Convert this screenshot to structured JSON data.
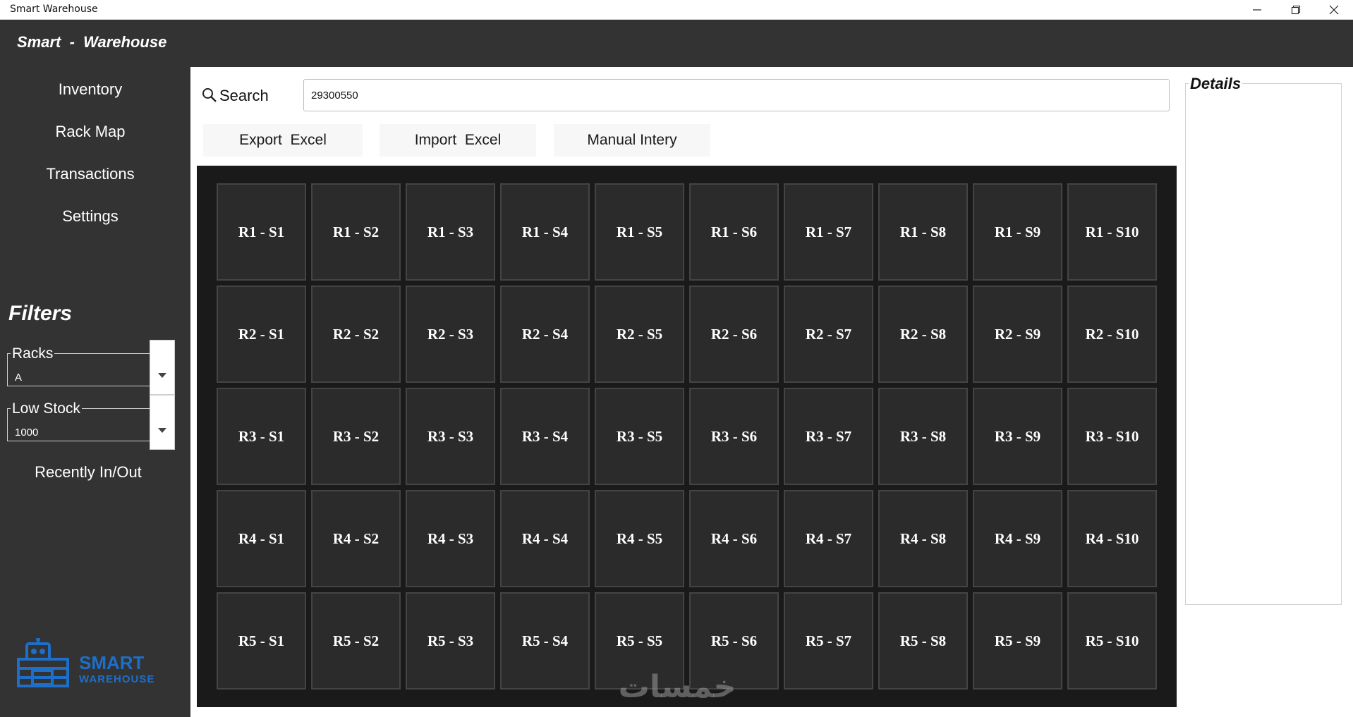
{
  "window": {
    "title": "Smart Warehouse"
  },
  "sidebar": {
    "brand": "Smart  -  Warehouse",
    "nav": [
      {
        "label": "Inventory"
      },
      {
        "label": "Rack Map"
      },
      {
        "label": "Transactions"
      },
      {
        "label": "Settings"
      }
    ],
    "filters_title": "Filters",
    "racks_filter": {
      "label": "Racks",
      "value": "A"
    },
    "low_stock_filter": {
      "label": "Low Stock",
      "value": "1000"
    },
    "recent_label": "Recently In/Out",
    "logo": {
      "line1": "SMART",
      "line2": "WAREHOUSE",
      "color": "#1e6fc9"
    }
  },
  "main": {
    "search_label": "Search",
    "search_value": "29300550",
    "buttons": {
      "export": "Export  Excel",
      "import": "Import  Excel",
      "manual": "Manual Intery"
    },
    "racks": [
      [
        "R1 - S1",
        "R1 - S2",
        "R1 - S3",
        "R1 - S4",
        "R1 - S5",
        "R1 - S6",
        "R1 - S7",
        "R1 - S8",
        "R1 - S9",
        "R1 - S10"
      ],
      [
        "R2 - S1",
        "R2 - S2",
        "R2 - S3",
        "R2 - S4",
        "R2 - S5",
        "R2 - S6",
        "R2 - S7",
        "R2 - S8",
        "R2 - S9",
        "R2 - S10"
      ],
      [
        "R3 - S1",
        "R3 - S2",
        "R3 - S3",
        "R3 - S4",
        "R3 - S5",
        "R3 - S6",
        "R3 - S7",
        "R3 - S8",
        "R3 - S9",
        "R3 - S10"
      ],
      [
        "R4 - S1",
        "R4 - S2",
        "R4 - S3",
        "R4 - S4",
        "R4 - S5",
        "R4 - S6",
        "R4 - S7",
        "R4 - S8",
        "R4 - S9",
        "R4 - S10"
      ],
      [
        "R5 - S1",
        "R5 - S2",
        "R5 - S3",
        "R5 - S4",
        "R5 - S5",
        "R5 - S6",
        "R5 - S7",
        "R5 - S8",
        "R5 - S9",
        "R5 - S10"
      ]
    ],
    "watermark": "خمسات"
  },
  "details": {
    "title": "Details"
  },
  "colors": {
    "sidebar_bg": "#333333",
    "grid_bg": "#1a1a1a",
    "cell_bg": "#2b2b2b",
    "accent": "#1e6fc9"
  }
}
